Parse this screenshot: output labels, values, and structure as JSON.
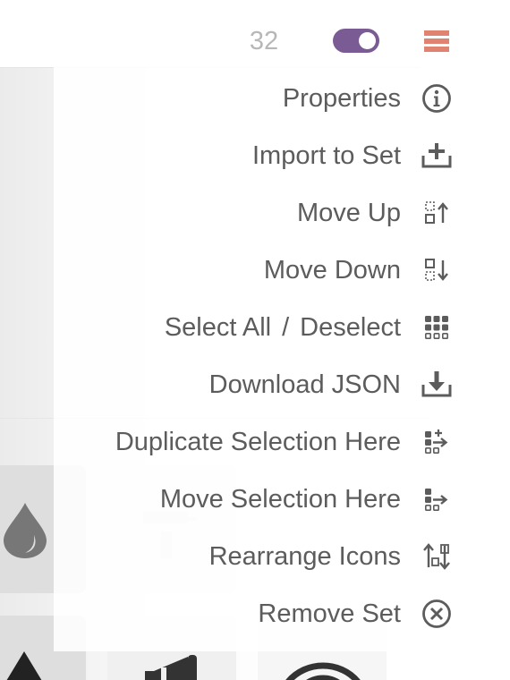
{
  "header": {
    "count": "32",
    "toggle_state": "on",
    "toggle_color": "#7b5b93",
    "menu_icon": "hamburger-menu-icon",
    "menu_icon_color": "#e08370"
  },
  "menu": {
    "items": [
      {
        "label": "Properties",
        "icon": "info-circle-icon"
      },
      {
        "label": "Import to Set",
        "icon": "import-tray-icon"
      },
      {
        "label": "Move Up",
        "icon": "move-up-icon"
      },
      {
        "label": "Move Down",
        "icon": "move-down-icon"
      },
      {
        "label_left": "Select All",
        "separator": "/",
        "label_right": "Deselect",
        "icon": "grid-select-icon"
      },
      {
        "label": "Download JSON",
        "icon": "download-tray-icon"
      },
      {
        "label": "Duplicate Selection Here",
        "icon": "duplicate-selection-icon"
      },
      {
        "label": "Move Selection Here",
        "icon": "move-selection-icon"
      },
      {
        "label": "Rearrange Icons",
        "icon": "rearrange-icon"
      },
      {
        "label": "Remove Set",
        "icon": "close-circle-icon"
      }
    ],
    "text_color": "#5c5c5c"
  },
  "background": {
    "tile_icons": [
      "droplet-icon",
      "paint-roller-icon",
      "image-icon",
      "triangle-icon",
      "megaphone-icon",
      "wifi-icon"
    ]
  }
}
